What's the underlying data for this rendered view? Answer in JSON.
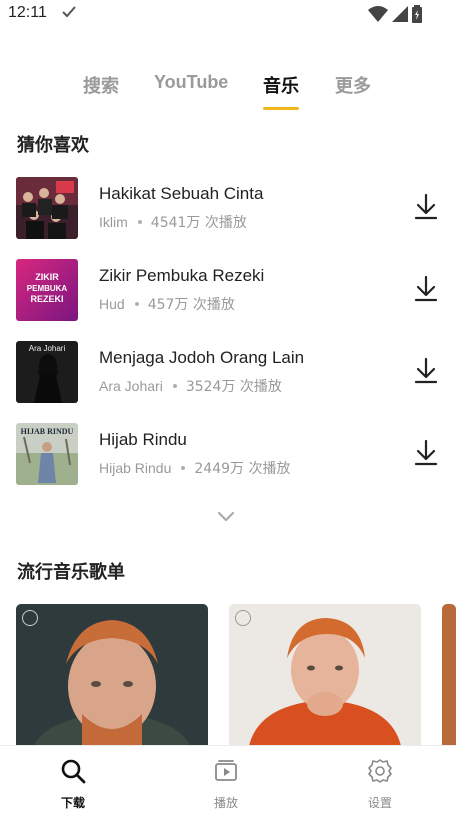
{
  "status_bar": {
    "time": "12:11"
  },
  "tabs": [
    {
      "label": "搜索"
    },
    {
      "label": "YouTube"
    },
    {
      "label": "音乐"
    },
    {
      "label": "更多"
    }
  ],
  "active_tab": "音乐",
  "sections": {
    "recommended_title": "猜你喜欢",
    "playlists_title": "流行音乐歌单"
  },
  "songs": [
    {
      "title": "Hakikat Sebuah Cinta",
      "artist": "Iklim",
      "plays": "4541万 次播放"
    },
    {
      "title": "Zikir Pembuka Rezeki",
      "artist": "Hud",
      "plays": "457万 次播放"
    },
    {
      "title": "Menjaga Jodoh Orang Lain",
      "artist": "Ara Johari",
      "plays": "3524万 次播放"
    },
    {
      "title": "Hijab Rindu",
      "artist": "Hijab Rindu",
      "plays": "2449万 次播放"
    }
  ],
  "covers": {
    "zikir_text": [
      "ZIKIR",
      "PEMBUKA",
      "REZEKI"
    ],
    "ara_text": "Ara Johari",
    "hijab_text": "HIJAB RINDU"
  },
  "bottom_nav": [
    {
      "label": "下载",
      "icon": "search-icon",
      "active": true
    },
    {
      "label": "播放",
      "icon": "play-library-icon",
      "active": false
    },
    {
      "label": "设置",
      "icon": "gear-icon",
      "active": false
    }
  ],
  "colors": {
    "accent": "#f2b71c",
    "text_primary": "#222222",
    "text_secondary": "#9a9a9a"
  }
}
